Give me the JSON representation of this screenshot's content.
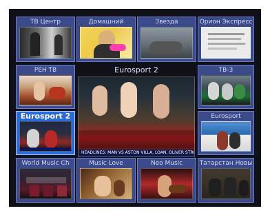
{
  "tiles": [
    {
      "label": "ТВ Центр"
    },
    {
      "label": "Домашний"
    },
    {
      "label": "Звезда"
    },
    {
      "label": "Орион Экспресс"
    },
    {
      "label": "РЕН ТВ"
    },
    {
      "label": "ТВ-3"
    },
    {
      "label": "Eurosport 2"
    },
    {
      "label": "Eurosport"
    },
    {
      "label": "World Music Ch"
    },
    {
      "label": "Music Love"
    },
    {
      "label": "Neo Music"
    },
    {
      "label": "Татарстан Новы"
    }
  ],
  "preview": {
    "label": "Eurosport 2",
    "ticker": "HEADLINES: MAN VS ASTON VILLA, LOAN, OLIVER STRIKES"
  }
}
